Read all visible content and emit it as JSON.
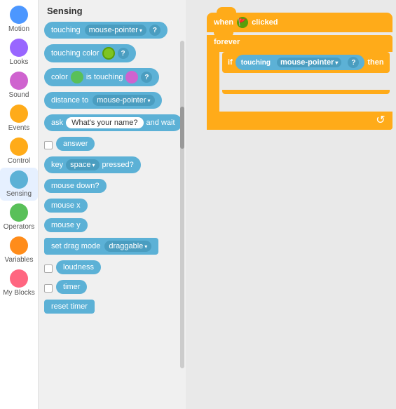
{
  "sidebar": {
    "items": [
      {
        "label": "Motion",
        "color_class": "circle-motion"
      },
      {
        "label": "Looks",
        "color_class": "circle-looks"
      },
      {
        "label": "Sound",
        "color_class": "circle-sound"
      },
      {
        "label": "Events",
        "color_class": "circle-events"
      },
      {
        "label": "Control",
        "color_class": "circle-control"
      },
      {
        "label": "Sensing",
        "color_class": "circle-sensing",
        "active": true
      },
      {
        "label": "Operators",
        "color_class": "circle-operators"
      },
      {
        "label": "Variables",
        "color_class": "circle-variables"
      },
      {
        "label": "My Blocks",
        "color_class": "circle-myblocks"
      }
    ]
  },
  "blocks_panel": {
    "title": "Sensing",
    "blocks": [
      {
        "type": "touching",
        "label": "touching",
        "dropdown": "mouse-pointer",
        "has_question": true
      },
      {
        "type": "touching_color",
        "label": "touching color",
        "has_question": true
      },
      {
        "type": "color_touching",
        "label": "color  is touching",
        "has_question": true
      },
      {
        "type": "distance_to",
        "label": "distance to",
        "dropdown": "mouse-pointer"
      },
      {
        "type": "ask",
        "label": "ask",
        "input": "What's your name?",
        "suffix": "and wait"
      },
      {
        "type": "answer",
        "label": "answer",
        "has_checkbox": true
      },
      {
        "type": "key_pressed",
        "label": "key",
        "dropdown": "space",
        "suffix": "pressed?"
      },
      {
        "type": "mouse_down",
        "label": "mouse down?"
      },
      {
        "type": "mouse_x",
        "label": "mouse x"
      },
      {
        "type": "mouse_y",
        "label": "mouse y"
      },
      {
        "type": "set_drag_mode",
        "label": "set drag mode",
        "dropdown": "draggable"
      },
      {
        "type": "loudness",
        "label": "loudness",
        "has_checkbox": true
      },
      {
        "type": "timer",
        "label": "timer",
        "has_checkbox": true
      },
      {
        "type": "reset_timer",
        "label": "reset timer"
      }
    ]
  },
  "canvas": {
    "when_flag_clicked": "when  clicked",
    "forever_label": "forever",
    "if_label": "if",
    "then_label": "then",
    "touching_label": "touching",
    "mouse_pointer_label": "mouse-pointer",
    "question_mark": "?"
  },
  "colors": {
    "sensing": "#5CB1D6",
    "control": "#FFAB19",
    "green": "#59C059",
    "flag_green": "#4CAF50"
  }
}
